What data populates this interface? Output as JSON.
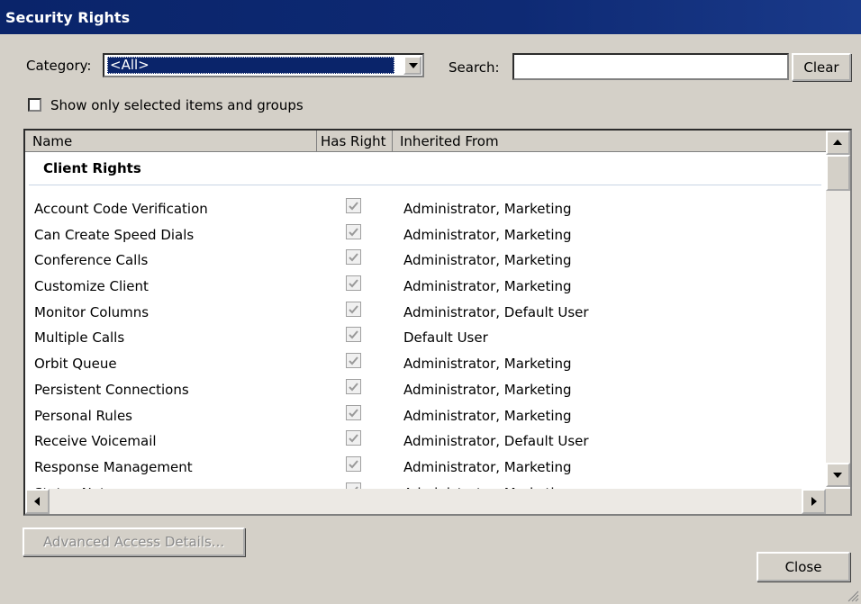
{
  "window": {
    "title": "Security Rights"
  },
  "filters": {
    "category_label": "Category:",
    "category_value": "<All>",
    "search_label": "Search:",
    "search_value": "",
    "clear_label": "Clear",
    "show_selected_label": "Show only selected items and groups",
    "show_selected_checked": false
  },
  "list": {
    "columns": [
      "Name",
      "Has Right",
      "Inherited From"
    ],
    "group_title": "Client Rights",
    "rows": [
      {
        "name": "Account Code Verification",
        "has_right": true,
        "inherited_from": "Administrator, Marketing"
      },
      {
        "name": "Can Create Speed Dials",
        "has_right": true,
        "inherited_from": "Administrator, Marketing"
      },
      {
        "name": "Conference Calls",
        "has_right": true,
        "inherited_from": "Administrator, Marketing"
      },
      {
        "name": "Customize Client",
        "has_right": true,
        "inherited_from": "Administrator, Marketing"
      },
      {
        "name": "Monitor Columns",
        "has_right": true,
        "inherited_from": "Administrator, Default User"
      },
      {
        "name": "Multiple Calls",
        "has_right": true,
        "inherited_from": "Default User"
      },
      {
        "name": "Orbit Queue",
        "has_right": true,
        "inherited_from": "Administrator, Marketing"
      },
      {
        "name": "Persistent Connections",
        "has_right": true,
        "inherited_from": "Administrator, Marketing"
      },
      {
        "name": "Personal Rules",
        "has_right": true,
        "inherited_from": "Administrator, Marketing"
      },
      {
        "name": "Receive Voicemail",
        "has_right": true,
        "inherited_from": "Administrator, Default User"
      },
      {
        "name": "Response Management",
        "has_right": true,
        "inherited_from": "Administrator, Marketing"
      },
      {
        "name": "Status Notes",
        "has_right": true,
        "inherited_from": "Administrator, Marketing"
      }
    ]
  },
  "buttons": {
    "advanced_label": "Advanced Access Details...",
    "close_label": "Close"
  },
  "colors": {
    "title_bar": "#0a246a",
    "selection": "#0a246a",
    "dialog_bg": "#d4d0c8"
  }
}
